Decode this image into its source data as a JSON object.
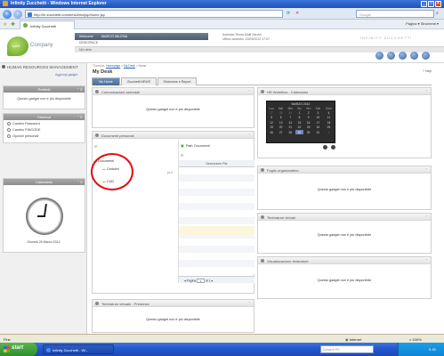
{
  "browser": {
    "title": "Infinity Zucchetti - Windows Internet Explorer",
    "address": "http://hr.zucchetti.com/ems3/ms/jsp/home.jsp",
    "search_placeholder": "Google",
    "tab_label": "Infinity Zucchetti",
    "commands": "Pagina ▾  Strumenti ▾",
    "status_left": "Fine",
    "status_zone": "Internet",
    "zoom": "100%"
  },
  "app": {
    "logo_word": "Company",
    "logo_leaf": "Spirit",
    "welcome_label": "Welcome",
    "user_name": "MARCO MILENA",
    "desk_label": "DESKSPACE",
    "desk_sub": "Mio desk",
    "company_line1": "Azienda: Roma Multi Servizi",
    "company_line2": "Ultimo accesso: 20/03/2012 17:07",
    "brand": "INFINITY ZUCCHETTI"
  },
  "sidebar": {
    "title": "HUMAN RESOURCES MANAGEMENT",
    "top_link": "Aggiungi gadget",
    "preferiti": {
      "header": "Preferiti",
      "message": "Questo gadget non è più disponibile"
    },
    "shortcuts": {
      "header": "Shortcut",
      "items": [
        "Cambio Password",
        "Cambio PINCODE",
        "Opzioni personali"
      ]
    },
    "clock": {
      "header": "Calendario",
      "date": "Giovedì 29 Marzo 2012"
    }
  },
  "main": {
    "breadcrumb_prefix": "Ti trovi in:",
    "breadcrumb_link1": "Homepage",
    "breadcrumb_link2": "My Desk",
    "breadcrumb_last": "Home",
    "title": "My Desk",
    "help": "Help",
    "tabs": [
      "My Home",
      "Zucchetti NEWS",
      "Sintomme e Report"
    ]
  },
  "gadgets": {
    "comunicazioni": {
      "title": "Comunicazioni aziendali",
      "message": "Questo gadget non è più disponibile"
    },
    "documenti": {
      "title": "Documenti personali",
      "path_label": "Path: Documenti",
      "tree_root": "Documenti",
      "tree_items": [
        "Cedolini",
        "CUD"
      ],
      "column_header": "Descrizione File",
      "pager_label": "Pagina",
      "pager_page": "1",
      "pager_of": "di",
      "pager_total": "1",
      "folder_count": "pz 0"
    },
    "hrworkflow": {
      "title": "HR Workflow - Calendario",
      "month": "MARZO 2012",
      "weekdays": [
        "Lun",
        "Mar",
        "Mer",
        "Gio",
        "Ven",
        "Sab",
        "Dom"
      ],
      "weeks": [
        [
          "27",
          "28",
          "29",
          "1",
          "2",
          "3",
          "4"
        ],
        [
          "5",
          "6",
          "7",
          "8",
          "9",
          "10",
          "11"
        ],
        [
          "12",
          "13",
          "14",
          "15",
          "16",
          "17",
          "18"
        ],
        [
          "19",
          "20",
          "21",
          "22",
          "23",
          "24",
          "25"
        ],
        [
          "26",
          "27",
          "28",
          "29",
          "30",
          "31",
          "1"
        ]
      ],
      "today": "29"
    },
    "foglio": {
      "title": "Foglio organizzativo",
      "message": "Questo gadget non è più disponibile"
    },
    "timbrature": {
      "title": "Timbrature virtuali",
      "message": "Questo gadget non è più disponibile"
    },
    "visualizzazione": {
      "title": "Visualizzazione timbrature",
      "message": "Questo gadget non è più disponibile"
    },
    "presenza": {
      "title": "Timbrature virtuale - Presenza",
      "message": "Questo gadget non è più disponibile"
    }
  },
  "taskbar": {
    "start": "start",
    "task_item": "Infinity Zucchetti - Wi...",
    "search_placeholder": "Cerca in PC",
    "time": "9.45"
  },
  "colors": {
    "accent": "#4a6d96",
    "annotation_circle": "#e01010"
  }
}
